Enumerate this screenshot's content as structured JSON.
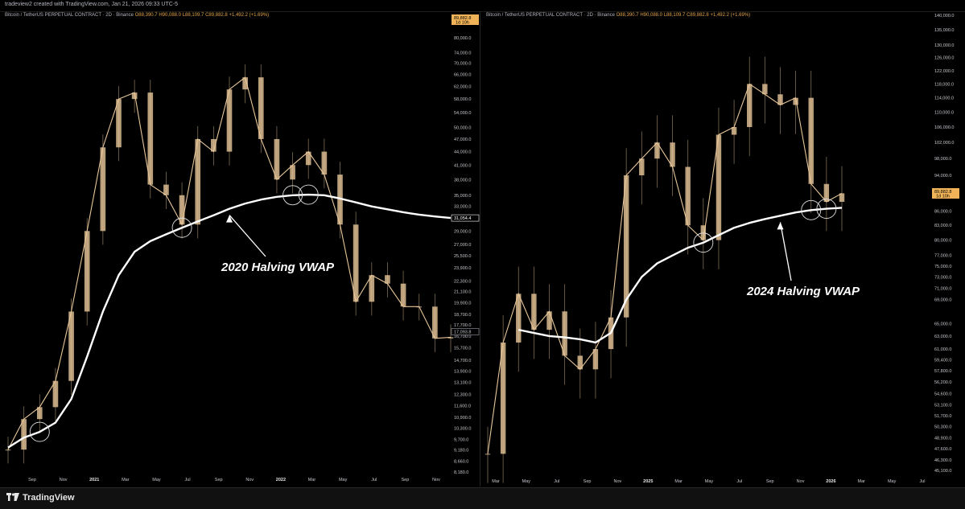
{
  "header": {
    "title": "tradeview2 created with TradingView.com, Jan 21, 2026 09:33 UTC-5"
  },
  "footer": {
    "brand": "TradingView"
  },
  "colors": {
    "background": "#000000",
    "candle": "#e8c79a",
    "vwap": "#ffffff",
    "price_label": "#f0b357",
    "accent_text": "#e3a34a"
  },
  "chart_data": [
    {
      "type": "line",
      "symbol": "Bitcoin / TetherUS PERPETUAL CONTRACT · 2D · Binance",
      "ohlc": {
        "open": "O88,390.7",
        "high": "H90,088.0",
        "low": "L88,109.7",
        "close": "C89,882.8",
        "change": "+1,492.2 (+1.69%)"
      },
      "price_axis_labels": [
        "80,000.0",
        "74,000.0",
        "70,000.0",
        "66,000.0",
        "62,000.0",
        "58,000.0",
        "54,000.0",
        "50,000.0",
        "47,000.0",
        "44,000.0",
        "41,000.0",
        "38,000.0",
        "35,000.0",
        "33,000.0",
        "31,000.0",
        "29,000.0",
        "27,000.0",
        "25,500.0",
        "23,900.0",
        "22,300.0",
        "21,100.0",
        "19,900.0",
        "18,700.0",
        "17,700.0",
        "16,700.0",
        "15,700.0",
        "14,700.0",
        "13,900.0",
        "13,100.0",
        "12,300.0",
        "11,600.0",
        "10,900.0",
        "10,300.0",
        "9,700.0",
        "9,180.0",
        "8,660.0",
        "8,180.0"
      ],
      "price_tags": {
        "last": "89,882.8",
        "countdown": "1d 10h",
        "vwap": "31,054.4",
        "secondary": "17,093.8"
      },
      "time_axis_labels": [
        "Sep",
        "Nov",
        "2021",
        "Mar",
        "May",
        "Jul",
        "Sep",
        "Nov",
        "2022",
        "Mar",
        "May",
        "Jul",
        "Sep",
        "Nov"
      ],
      "annotation": "2020 Halving VWAP",
      "series": [
        {
          "name": "Price (close)",
          "x": [
            "2020-08",
            "2020-09",
            "2020-10",
            "2020-11",
            "2020-12",
            "2021-01",
            "2021-02",
            "2021-03",
            "2021-04",
            "2021-05",
            "2021-06",
            "2021-07",
            "2021-08",
            "2021-09",
            "2021-10",
            "2021-11",
            "2021-12",
            "2022-01",
            "2022-02",
            "2022-03",
            "2022-04",
            "2022-05",
            "2022-06",
            "2022-07",
            "2022-08",
            "2022-09",
            "2022-10",
            "2022-11",
            "2022-12"
          ],
          "values": [
            9200,
            10800,
            11500,
            13200,
            19000,
            29000,
            45000,
            58000,
            60000,
            37000,
            35000,
            30000,
            47000,
            44000,
            61000,
            65000,
            47000,
            38000,
            41000,
            44000,
            39000,
            30000,
            20000,
            23000,
            22000,
            19500,
            19500,
            16500,
            16600
          ]
        },
        {
          "name": "2020 Halving VWAP",
          "x": [
            "2020-08",
            "2020-09",
            "2020-10",
            "2020-11",
            "2020-12",
            "2021-01",
            "2021-02",
            "2021-03",
            "2021-04",
            "2021-05",
            "2021-06",
            "2021-07",
            "2021-08",
            "2021-09",
            "2021-10",
            "2021-11",
            "2021-12",
            "2022-01",
            "2022-02",
            "2022-03",
            "2022-04",
            "2022-05",
            "2022-06",
            "2022-07",
            "2022-08",
            "2022-09",
            "2022-10",
            "2022-11",
            "2022-12"
          ],
          "values": [
            9300,
            9800,
            10100,
            10600,
            12000,
            15000,
            19000,
            23000,
            26000,
            27500,
            28500,
            29500,
            30500,
            31500,
            32600,
            33500,
            34200,
            34700,
            35000,
            35100,
            35000,
            34400,
            33700,
            33000,
            32500,
            32000,
            31600,
            31300,
            31054
          ]
        }
      ]
    },
    {
      "type": "line",
      "symbol": "Bitcoin / TetherUS PERPETUAL CONTRACT · 2D · Binance",
      "ohlc": {
        "open": "O88,390.7",
        "high": "H90,088.0",
        "low": "L88,109.7",
        "close": "C89,882.8",
        "change": "+1,492.2 (+1.69%)"
      },
      "price_axis_labels": [
        "140,000.0",
        "135,000.0",
        "130,000.0",
        "126,000.0",
        "122,000.0",
        "118,000.0",
        "114,000.0",
        "110,000.0",
        "106,000.0",
        "102,000.0",
        "98,000.0",
        "94,000.0",
        "90,000.0",
        "86,000.0",
        "83,000.0",
        "80,000.0",
        "77,000.0",
        "75,000.0",
        "73,000.0",
        "71,000.0",
        "69,000.0",
        "65,000.0",
        "63,000.0",
        "61,000.0",
        "59,400.0",
        "57,800.0",
        "56,200.0",
        "54,600.0",
        "53,100.0",
        "51,700.0",
        "50,300.0",
        "48,900.0",
        "47,600.0",
        "46,300.0",
        "45,100.0"
      ],
      "price_tags": {
        "last": "89,882.8",
        "countdown": "1d 10h"
      },
      "time_axis_labels": [
        "Mar",
        "May",
        "Jul",
        "Sep",
        "Nov",
        "2025",
        "Mar",
        "May",
        "Jul",
        "Sep",
        "Nov",
        "2026",
        "Mar",
        "May",
        "Jul"
      ],
      "annotation": "2024 Halving VWAP",
      "series": [
        {
          "name": "Price (close)",
          "x": [
            "2024-02",
            "2024-03",
            "2024-04",
            "2024-05",
            "2024-06",
            "2024-07",
            "2024-08",
            "2024-09",
            "2024-10",
            "2024-11",
            "2024-12",
            "2025-01",
            "2025-02",
            "2025-03",
            "2025-04",
            "2025-05",
            "2025-06",
            "2025-07",
            "2025-08",
            "2025-09",
            "2025-10",
            "2025-11",
            "2025-12",
            "2026-01"
          ],
          "values": [
            47000,
            62000,
            70000,
            64000,
            67000,
            60000,
            58000,
            61000,
            66000,
            94000,
            98000,
            102000,
            96000,
            83000,
            80000,
            104000,
            106000,
            118000,
            115000,
            112000,
            114000,
            92000,
            88000,
            89882
          ]
        },
        {
          "name": "2024 Halving VWAP",
          "x": [
            "2024-04",
            "2024-05",
            "2024-06",
            "2024-07",
            "2024-08",
            "2024-09",
            "2024-10",
            "2024-11",
            "2024-12",
            "2025-01",
            "2025-02",
            "2025-03",
            "2025-04",
            "2025-05",
            "2025-06",
            "2025-07",
            "2025-08",
            "2025-09",
            "2025-10",
            "2025-11",
            "2025-12",
            "2026-01"
          ],
          "values": [
            64000,
            63500,
            63000,
            62800,
            62500,
            62000,
            63500,
            69000,
            73000,
            75500,
            77000,
            78500,
            79500,
            81000,
            82500,
            83500,
            84300,
            85000,
            85700,
            86200,
            86500,
            86700
          ]
        }
      ]
    }
  ]
}
